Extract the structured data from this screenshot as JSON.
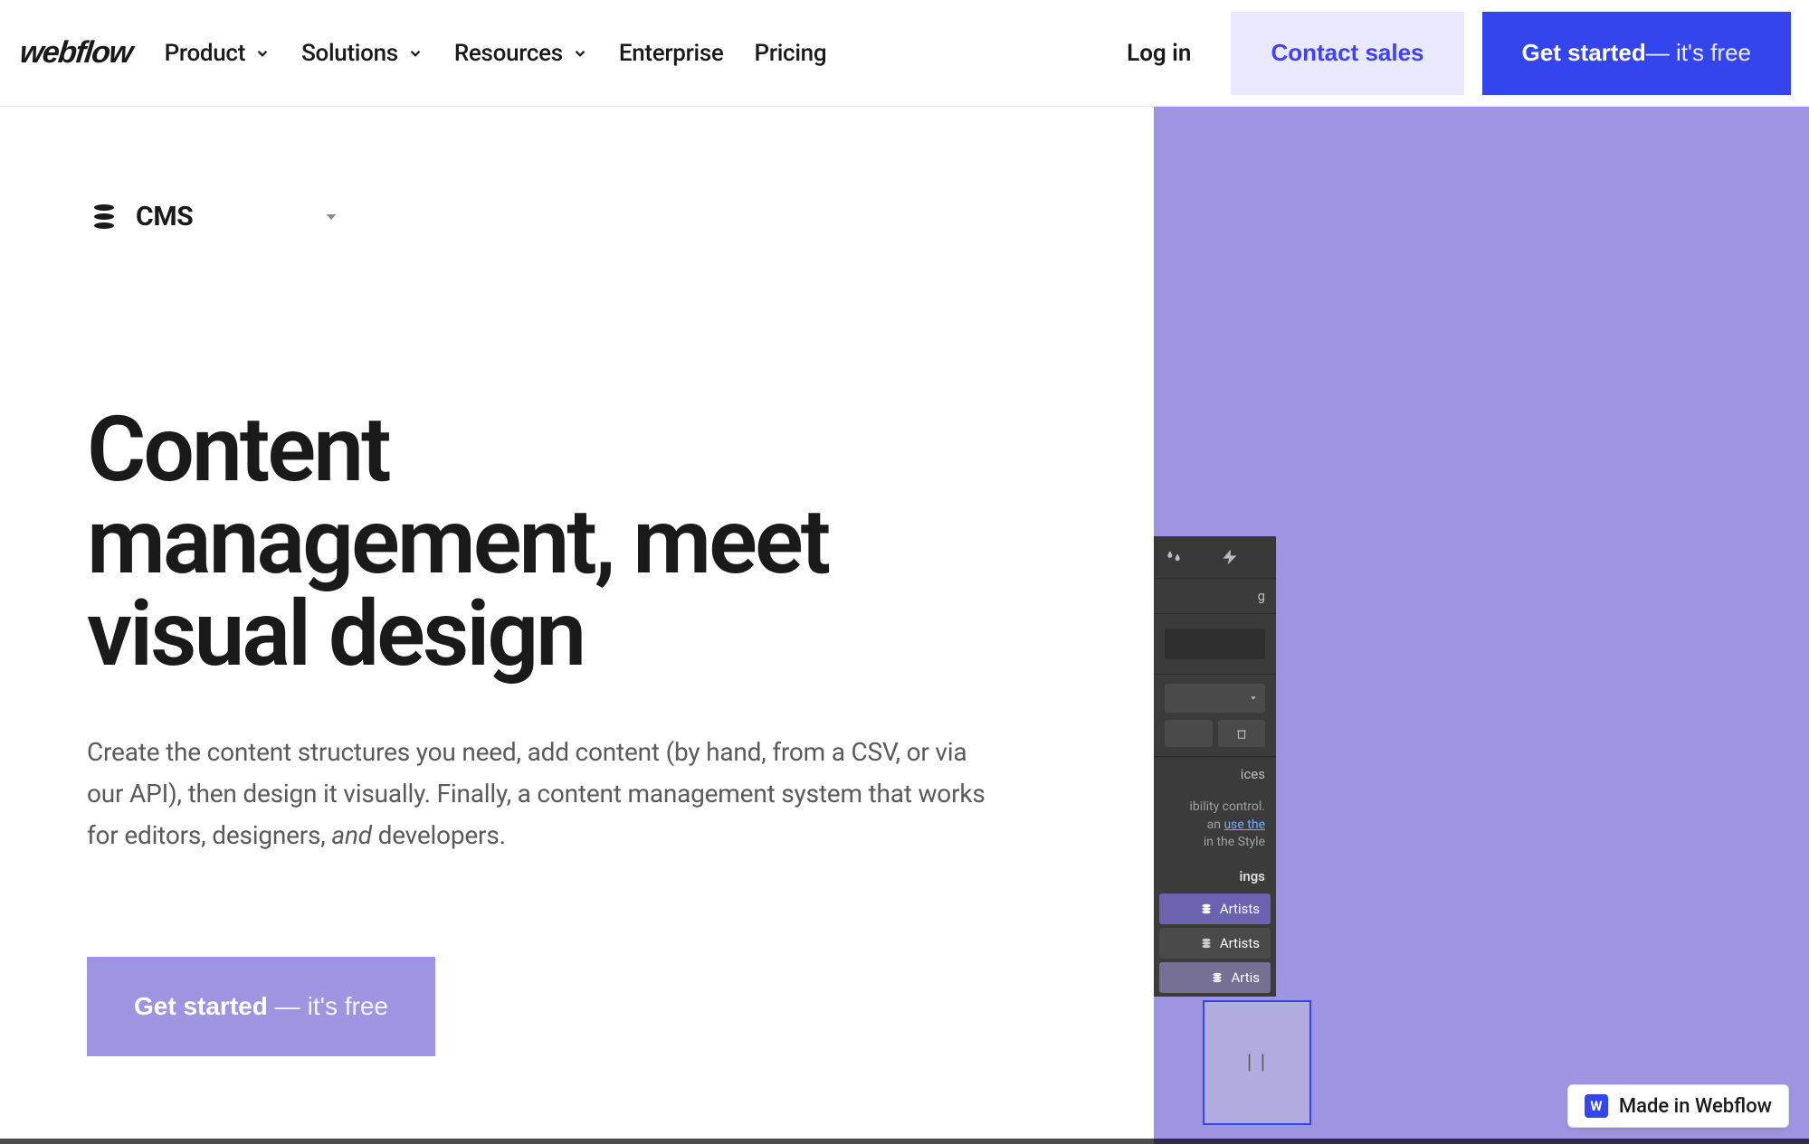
{
  "nav": {
    "logo": "webflow",
    "items": [
      "Product",
      "Solutions",
      "Resources",
      "Enterprise",
      "Pricing"
    ],
    "login": "Log in",
    "contact": "Contact sales",
    "cta_bold": "Get started",
    "cta_suffix": " — it's free"
  },
  "selector": {
    "label": "CMS"
  },
  "hero": {
    "title": "Content management, meet visual design",
    "sub_before": "Create the content structures you need, add content (by hand, from a CSV, or via our API), then design it visually. Finally, a content management system that works for editors, designers, ",
    "sub_em": "and",
    "sub_after": " developers.",
    "cta_bold": "Get started",
    "cta_suffix": " — it's free"
  },
  "panel": {
    "note_text1": "ibility control.",
    "note_link": "use the",
    "note_text2": " in the Style",
    "section": "ings",
    "collections": [
      "Artists",
      "Artists",
      "Artis"
    ],
    "note_ices": "ices"
  },
  "badge": {
    "icon_letter": "W",
    "text": "Made in Webflow"
  }
}
